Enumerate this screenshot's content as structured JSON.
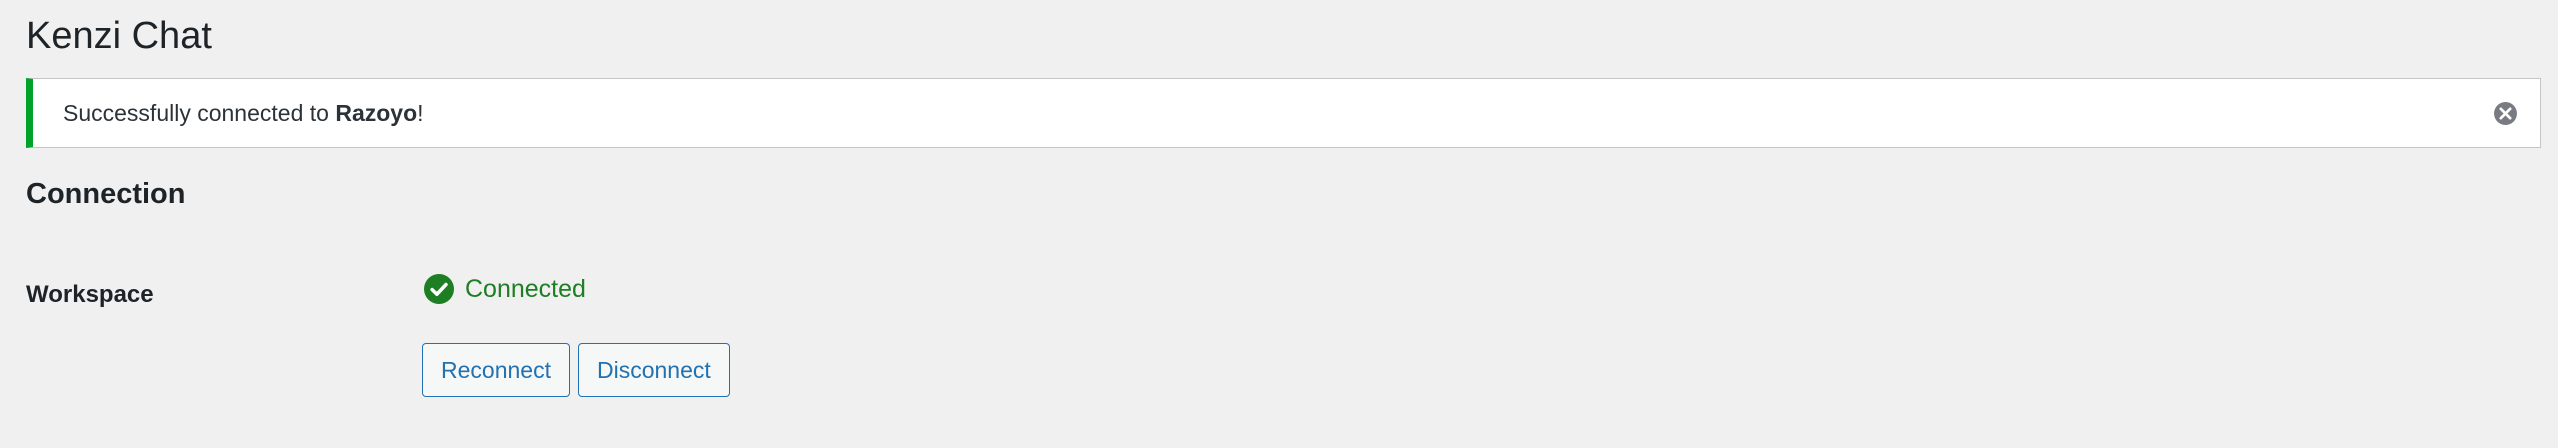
{
  "page": {
    "title": "Kenzi Chat"
  },
  "notice": {
    "prefix": "Successfully connected to ",
    "workspace_name": "Razoyo",
    "suffix": "!",
    "accent_color": "#00a32a",
    "dismiss_icon": "close-circle-icon"
  },
  "connection": {
    "heading": "Connection",
    "workspace_label": "Workspace",
    "status": {
      "icon": "check-circle-icon",
      "text": "Connected",
      "color": "#1e7e24"
    },
    "buttons": {
      "reconnect_label": "Reconnect",
      "disconnect_label": "Disconnect"
    }
  },
  "colors": {
    "background": "#f0f0f1",
    "link_blue": "#2271b1"
  }
}
